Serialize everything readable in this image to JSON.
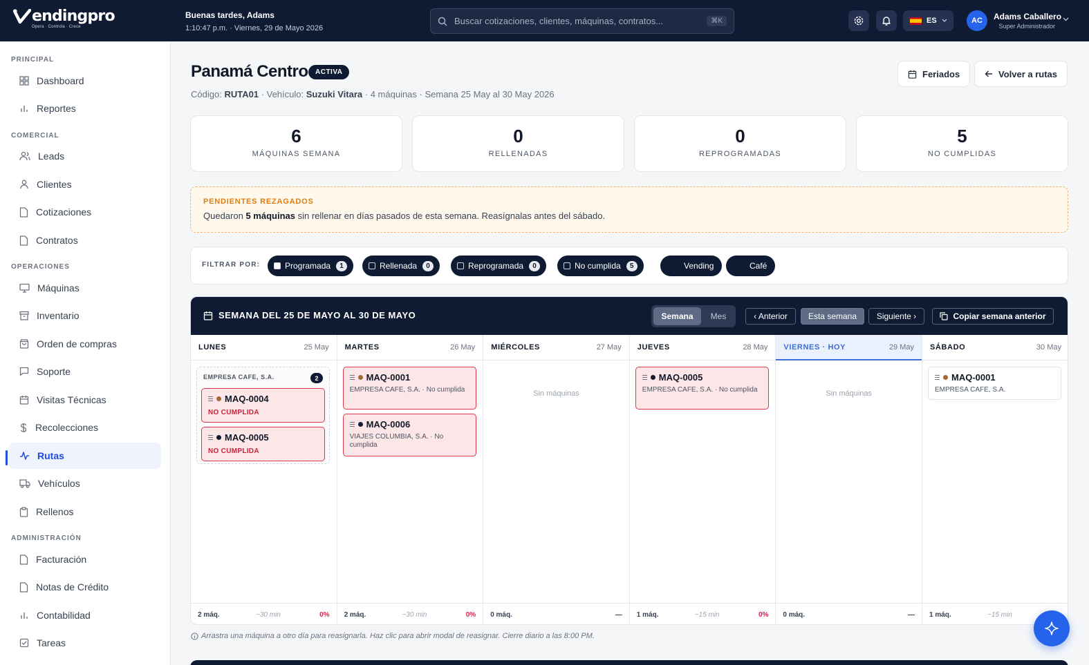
{
  "brand": {
    "logo_text": "endingpro",
    "tagline": "Opera · Controla · Crece"
  },
  "header": {
    "greeting": "Buenas tardes, Adams",
    "datetime": "1:10:47 p.m. · Viernes, 29 de Mayo 2026",
    "search_placeholder": "Buscar cotizaciones, clientes, máquinas, contratos...",
    "search_shortcut": "⌘K",
    "lang": "ES",
    "user_initials": "AC",
    "user_name": "Adams Caballero",
    "user_role": "Super Administrador"
  },
  "sidebar": {
    "sections": {
      "principal": "PRINCIPAL",
      "comercial": "COMERCIAL",
      "operaciones": "OPERACIONES",
      "administracion": "ADMINISTRACIÓN"
    },
    "items": {
      "dashboard": "Dashboard",
      "reportes": "Reportes",
      "leads": "Leads",
      "clientes": "Clientes",
      "cotizaciones": "Cotizaciones",
      "contratos": "Contratos",
      "maquinas": "Máquinas",
      "inventario": "Inventario",
      "orden": "Orden de compras",
      "soporte": "Soporte",
      "visitas": "Visitas Técnicas",
      "recolecciones": "Recolecciones",
      "rutas": "Rutas",
      "vehiculos": "Vehículos",
      "rellenos": "Rellenos",
      "facturacion": "Facturación",
      "notas": "Notas de Crédito",
      "contabilidad": "Contabilidad",
      "tareas": "Tareas"
    },
    "active": "rutas"
  },
  "page": {
    "title": "Panamá Centro",
    "status": "ACTIVA",
    "sub": {
      "codigo_lbl": "Código:",
      "codigo": "RUTA01",
      "vehiculo_lbl": "· Vehículo:",
      "vehiculo": "Suzuki Vitara",
      "rest": "· 4 máquinas · Semana 25 May al 30 May 2026"
    },
    "btn_feriados": "Feriados",
    "btn_volver": "Volver a rutas"
  },
  "stats": [
    {
      "value": "6",
      "label": "MÁQUINAS SEMANA"
    },
    {
      "value": "0",
      "label": "RELLENADAS"
    },
    {
      "value": "0",
      "label": "REPROGRAMADAS"
    },
    {
      "value": "5",
      "label": "NO CUMPLIDAS"
    }
  ],
  "alert": {
    "title": "PENDIENTES REZAGADOS",
    "pre": "Quedaron",
    "strong": "5 máquinas",
    "post": "sin rellenar en días pasados de esta semana. Reasígnalas antes del sábado."
  },
  "filters": {
    "label": "FILTRAR POR:",
    "status": [
      {
        "label": "Programada",
        "count": "1",
        "checked": true
      },
      {
        "label": "Rellenada",
        "count": "0",
        "checked": false
      },
      {
        "label": "Reprogramada",
        "count": "0",
        "checked": false
      },
      {
        "label": "No cumplida",
        "count": "5",
        "checked": false
      }
    ],
    "types": [
      "Vending",
      "Café"
    ]
  },
  "calendar": {
    "title": "SEMANA DEL 25 DE MAYO AL 30 DE MAYO",
    "view_week": "Semana",
    "view_month": "Mes",
    "prev": "‹ Anterior",
    "this_week": "Esta semana",
    "next": "Siguiente ›",
    "copy": "Copiar semana anterior",
    "empty_label": "Sin máquinas",
    "days": [
      {
        "name": "LUNES",
        "date": "25 May",
        "q": "2 máq.",
        "t": "~30 min",
        "p": "0%"
      },
      {
        "name": "MARTES",
        "date": "26 May",
        "q": "2 máq.",
        "t": "~30 min",
        "p": "0%"
      },
      {
        "name": "MIÉRCOLES",
        "date": "27 May",
        "q": "0 máq.",
        "t": "",
        "p": "—"
      },
      {
        "name": "JUEVES",
        "date": "28 May",
        "q": "1 máq.",
        "t": "~15 min",
        "p": "0%"
      },
      {
        "name": "VIERNES · HOY",
        "date": "29 May",
        "q": "0 máq.",
        "t": "",
        "p": "—"
      },
      {
        "name": "SÁBADO",
        "date": "30 May",
        "q": "1 máq.",
        "t": "~15 min",
        "p": ""
      }
    ],
    "group": {
      "client": "EMPRESA CAFE, S.A.",
      "count": "2"
    },
    "cards": {
      "mon1": {
        "id": "MAQ-0004",
        "status": "NO CUMPLIDA"
      },
      "mon2": {
        "id": "MAQ-0005",
        "status": "NO CUMPLIDA"
      },
      "tue1": {
        "id": "MAQ-0001",
        "sub": "EMPRESA CAFE, S.A. · No cumplida"
      },
      "tue2": {
        "id": "MAQ-0006",
        "sub": "VIAJES COLUMBIA, S.A. · No cumplida"
      },
      "thu1": {
        "id": "MAQ-0005",
        "sub": "EMPRESA CAFE, S.A. · No cumplida"
      },
      "sat1": {
        "id": "MAQ-0001",
        "sub": "EMPRESA CAFE, S.A."
      }
    },
    "colors": {
      "cafe": "#a3683a",
      "vending": "#0f1b33"
    }
  },
  "note": "Arrastra una máquina a otro día para reasignarla. Haz clic para abrir modal de reasignar. Cierre diario a las 8:00 PM."
}
